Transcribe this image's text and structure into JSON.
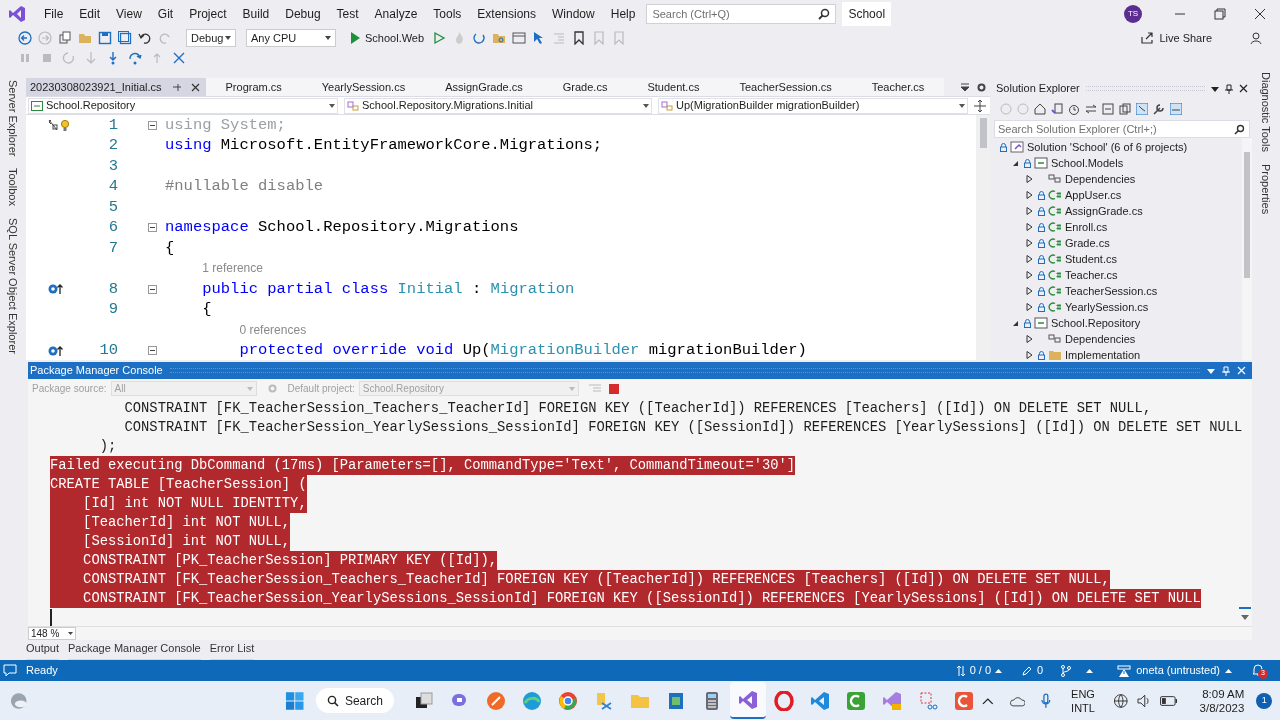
{
  "title_bar": {
    "menu": [
      "File",
      "Edit",
      "View",
      "Git",
      "Project",
      "Build",
      "Debug",
      "Test",
      "Analyze",
      "Tools",
      "Extensions",
      "Window",
      "Help"
    ],
    "search": {
      "placeholder": "Search (Ctrl+Q)"
    },
    "solution_name": "School",
    "avatar": "TS"
  },
  "toolbar": {
    "configuration": "Debug",
    "platform": "Any CPU",
    "startup_project": "School.Web",
    "live_share": "Live Share"
  },
  "left_rail": [
    "Server Explorer",
    "Toolbox",
    "SQL Server Object Explorer"
  ],
  "editor": {
    "tabs": [
      {
        "label": "20230308023921_Initial.cs",
        "selected": true
      },
      {
        "label": "Program.cs",
        "selected": false
      },
      {
        "label": "YearlySession.cs",
        "selected": false
      },
      {
        "label": "AssignGrade.cs",
        "selected": false
      },
      {
        "label": "Grade.cs",
        "selected": false
      },
      {
        "label": "Student.cs",
        "selected": false
      },
      {
        "label": "TeacherSession.cs",
        "selected": false
      },
      {
        "label": "Teacher.cs",
        "selected": false
      }
    ],
    "navigation": [
      "School.Repository",
      "School.Repository.Migrations.Initial",
      "Up(MigrationBuilder migrationBuilder)"
    ],
    "lines": [
      {
        "kind": "code",
        "number": "1",
        "margin": {
          "kind": "lightbulb"
        },
        "expanded": true,
        "segments": [
          {
            "kind": "faded",
            "text": "using System;"
          }
        ]
      },
      {
        "kind": "code",
        "number": "2",
        "segments": [
          {
            "kind": "keyword",
            "text": "using "
          },
          {
            "kind": "plain",
            "text": "Microsoft.EntityFrameworkCore.Migrations;"
          }
        ]
      },
      {
        "kind": "code",
        "number": "3"
      },
      {
        "kind": "code",
        "number": "4",
        "segments": [
          {
            "kind": "directive",
            "text": "#nullable disable"
          }
        ]
      },
      {
        "kind": "code",
        "number": "5"
      },
      {
        "kind": "code",
        "number": "6",
        "expanded": true,
        "segments": [
          {
            "kind": "keyword",
            "text": "namespace "
          },
          {
            "kind": "plain",
            "text": "School.Repository.Migrations"
          }
        ]
      },
      {
        "kind": "code",
        "number": "7",
        "segments": [
          {
            "kind": "plain",
            "text": "{"
          }
        ]
      },
      {
        "kind": "lens",
        "text": "    1 reference"
      },
      {
        "kind": "code",
        "number": "8",
        "margin": {
          "kind": "override"
        },
        "expanded": true,
        "segments": [
          {
            "kind": "keyword",
            "text": "    public partial class "
          },
          {
            "kind": "type",
            "text": "Initial"
          },
          {
            "kind": "plain",
            "text": " : "
          },
          {
            "kind": "type",
            "text": "Migration"
          }
        ]
      },
      {
        "kind": "code",
        "number": "9",
        "segments": [
          {
            "kind": "plain",
            "text": "    {"
          }
        ]
      },
      {
        "kind": "lens",
        "text": "        0 references"
      },
      {
        "kind": "code",
        "number": "10",
        "margin": {
          "kind": "override"
        },
        "expanded": true,
        "segments": [
          {
            "kind": "keyword",
            "text": "        protected override void "
          },
          {
            "kind": "plain",
            "text": "Up("
          },
          {
            "kind": "type",
            "text": "MigrationBuilder"
          },
          {
            "kind": "plain",
            "text": " migrationBuilder)"
          }
        ]
      }
    ]
  },
  "solution_explorer": {
    "title": "Solution Explorer",
    "search": {
      "placeholder": "Search Solution Explorer (Ctrl+;)"
    },
    "tree": [
      {
        "kind": "solution",
        "label": "Solution 'School' (6 of 6 projects)",
        "children": [
          {
            "kind": "project",
            "label": "School.Models",
            "expanded": true,
            "children": [
              {
                "kind": "dependencies",
                "label": "Dependencies",
                "expanded": false
              },
              {
                "kind": "csharp",
                "label": "AppUser.cs",
                "expanded": false
              },
              {
                "kind": "csharp",
                "label": "AssignGrade.cs",
                "expanded": false
              },
              {
                "kind": "csharp",
                "label": "Enroll.cs",
                "expanded": false
              },
              {
                "kind": "csharp",
                "label": "Grade.cs",
                "expanded": false
              },
              {
                "kind": "csharp",
                "label": "Student.cs",
                "expanded": false
              },
              {
                "kind": "csharp",
                "label": "Teacher.cs",
                "expanded": false
              },
              {
                "kind": "csharp",
                "label": "TeacherSession.cs",
                "expanded": false
              },
              {
                "kind": "csharp",
                "label": "YearlySession.cs",
                "expanded": false
              }
            ]
          },
          {
            "kind": "project",
            "label": "School.Repository",
            "expanded": true,
            "children": [
              {
                "kind": "dependencies",
                "label": "Dependencies",
                "expanded": false
              },
              {
                "kind": "folder",
                "label": "Implementation",
                "expanded": false
              }
            ]
          }
        ]
      }
    ]
  },
  "right_rail": [
    "Diagnostic Tools",
    "Properties"
  ],
  "console": {
    "title": "Package Manager Console",
    "package_source_label": "Package source:",
    "package_source": "All",
    "default_project_label": "Default project:",
    "default_project": "School.Repository",
    "lines": [
      {
        "text": "         CONSTRAINT [FK_TeacherSession_Teachers_TeacherId] FOREIGN KEY ([TeacherId]) REFERENCES [Teachers] ([Id]) ON DELETE SET NULL,",
        "error": false
      },
      {
        "text": "         CONSTRAINT [FK_TeacherSession_YearlySessions_SessionId] FOREIGN KEY ([SessionId]) REFERENCES [YearlySessions] ([Id]) ON DELETE SET NULL",
        "error": false
      },
      {
        "text": "      );",
        "error": false
      },
      {
        "text": "Failed executing DbCommand (17ms) [Parameters=[], CommandType='Text', CommandTimeout='30']",
        "error": true
      },
      {
        "text": "CREATE TABLE [TeacherSession] (",
        "error": true
      },
      {
        "text": "    [Id] int NOT NULL IDENTITY,",
        "error": true
      },
      {
        "text": "    [TeacherId] int NOT NULL,",
        "error": true
      },
      {
        "text": "    [SessionId] int NOT NULL,",
        "error": true
      },
      {
        "text": "    CONSTRAINT [PK_TeacherSession] PRIMARY KEY ([Id]),",
        "error": true
      },
      {
        "text": "    CONSTRAINT [FK_TeacherSession_Teachers_TeacherId] FOREIGN KEY ([TeacherId]) REFERENCES [Teachers] ([Id]) ON DELETE SET NULL,",
        "error": true
      },
      {
        "text": "    CONSTRAINT [FK_TeacherSession_YearlySessions_SessionId] FOREIGN KEY ([SessionId]) REFERENCES [YearlySessions] ([Id]) ON DELETE SET NULL",
        "error": true
      }
    ],
    "zoom": "148 %"
  },
  "bottom_tabs": [
    {
      "label": "Output",
      "selected": false
    },
    {
      "label": "Package Manager Console",
      "selected": false
    },
    {
      "label": "Error List",
      "selected": false
    }
  ],
  "status_bar": {
    "message": "Ready",
    "line_changes": "0 / 0",
    "edits": "0",
    "account": "oneta (untrusted)",
    "notifications": "3"
  },
  "taskbar": {
    "search": "Search",
    "language": [
      "ENG",
      "INTL"
    ],
    "time": "8:09 AM",
    "date": "3/8/2023",
    "notification_count": "1"
  }
}
